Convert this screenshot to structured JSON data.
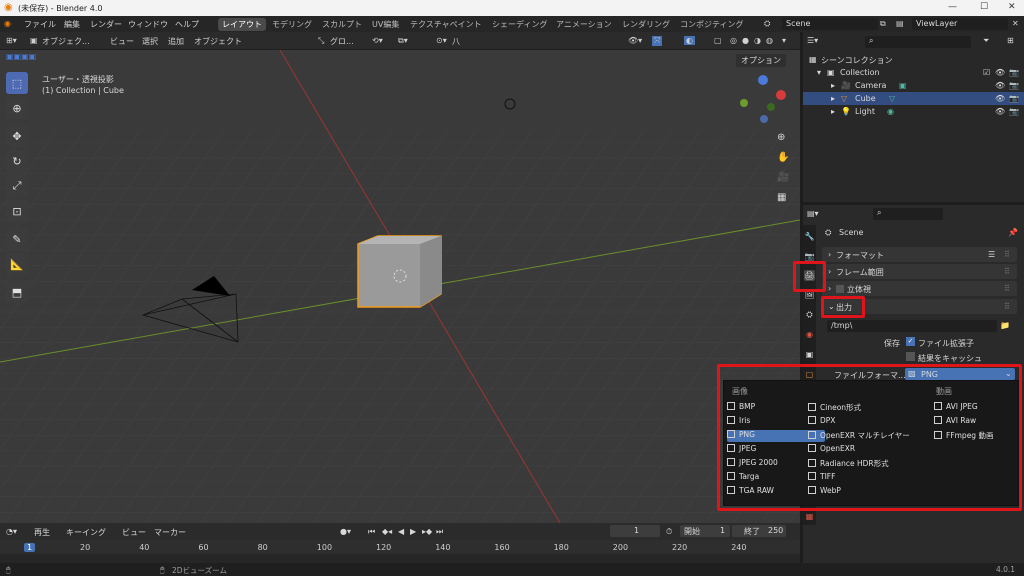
{
  "window": {
    "title": "(未保存) - Blender 4.0",
    "version": "4.0.1"
  },
  "menu": [
    "ファイル",
    "編集",
    "レンダー",
    "ウィンドウ",
    "ヘルプ"
  ],
  "workspaces": [
    "レイアウト",
    "モデリング",
    "スカルプト",
    "UV編集",
    "テクスチャペイント",
    "シェーディング",
    "アニメーション",
    "レンダリング",
    "コンポジティング"
  ],
  "scene_name": "Scene",
  "view_layer": "ViewLayer",
  "viewport": {
    "mode": "オブジェク...",
    "menus": [
      "ビュー",
      "選択",
      "追加",
      "オブジェクト"
    ],
    "transform": "グロ...",
    "options": "オプション",
    "view_label": "ユーザー・透視投影",
    "object_label": "(1) Collection | Cube"
  },
  "outliner": {
    "root": "シーンコレクション",
    "collection": "Collection",
    "items": [
      "Camera",
      "Cube",
      "Light"
    ]
  },
  "properties": {
    "context": "Scene",
    "panels": {
      "format": "フォーマット",
      "frame_range": "フレーム範囲",
      "stereo": "立体視",
      "output": "出力"
    },
    "output_path": "/tmp\\",
    "save_label": "保存",
    "file_ext": "ファイル拡張子",
    "cache": "結果をキャッシュ",
    "file_format_label": "ファイルフォーマ...",
    "file_format_value": "PNG"
  },
  "dropdown": {
    "image_header": "画像",
    "movie_header": "動画",
    "col1": [
      "BMP",
      "Iris",
      "PNG",
      "JPEG",
      "JPEG 2000",
      "Targa",
      "TGA RAW"
    ],
    "col2": [
      "Cineon形式",
      "DPX",
      "OpenEXR マルチレイヤー",
      "OpenEXR",
      "Radiance HDR形式",
      "TIFF",
      "WebP"
    ],
    "col3": [
      "AVI JPEG",
      "AVI Raw",
      "FFmpeg 動画"
    ],
    "selected": "PNG"
  },
  "timeline": {
    "menus": [
      "再生",
      "キーイング",
      "ビュー",
      "マーカー"
    ],
    "current_frame": "1",
    "start_label": "開始",
    "start": "1",
    "end_label": "終了",
    "end": "250",
    "ticks": [
      "1",
      "20",
      "40",
      "60",
      "80",
      "100",
      "120",
      "140",
      "160",
      "180",
      "200",
      "220",
      "240"
    ]
  },
  "status": {
    "hint": "2Dビューズーム"
  }
}
